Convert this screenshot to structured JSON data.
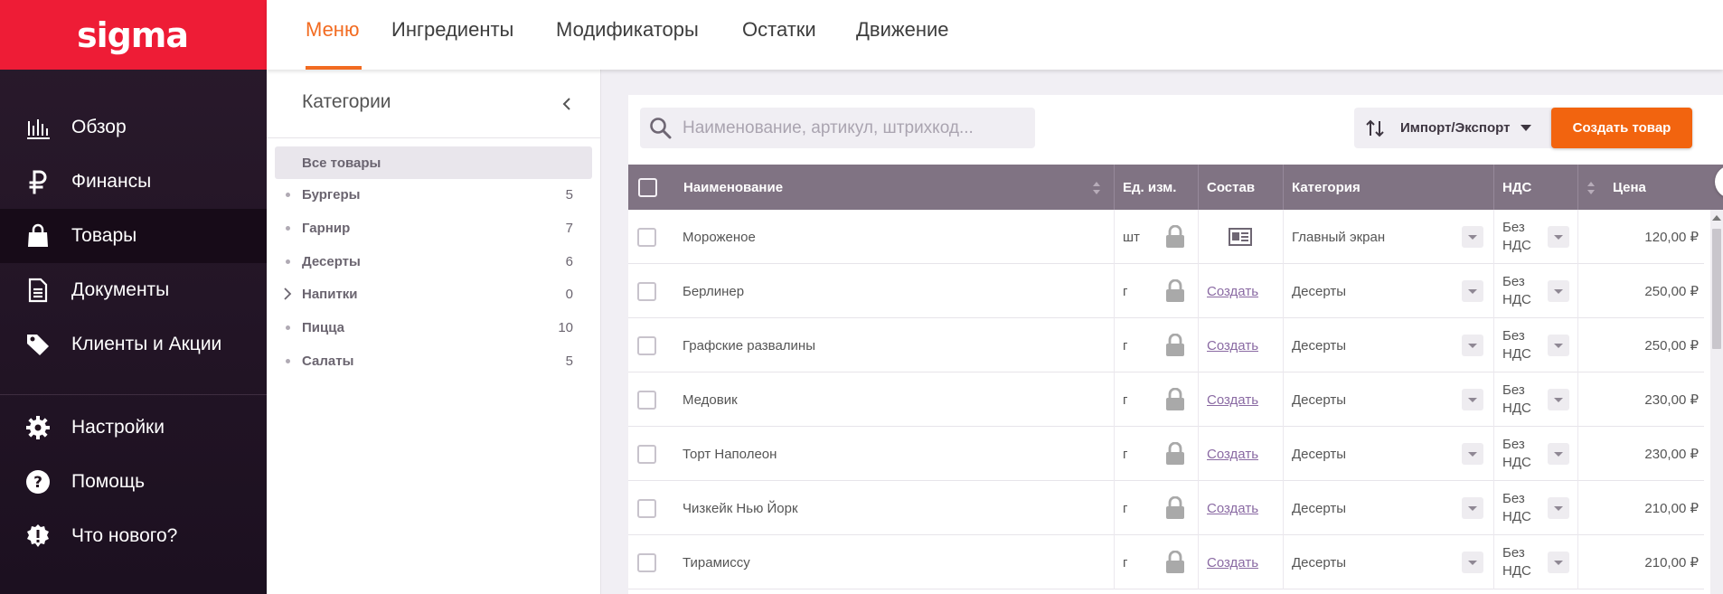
{
  "brand": {
    "logo": "sigma",
    "accent": "#f26b21",
    "brand_red": "#ee1c36"
  },
  "sidebar": {
    "items": [
      {
        "label": "Обзор",
        "icon": "chart-bars-icon"
      },
      {
        "label": "Финансы",
        "icon": "ruble-icon"
      },
      {
        "label": "Товары",
        "icon": "shopping-bag-icon",
        "active": true
      },
      {
        "label": "Документы",
        "icon": "document-icon"
      },
      {
        "label": "Клиенты и Акции",
        "icon": "tag-icon"
      }
    ],
    "bottom_items": [
      {
        "label": "Настройки",
        "icon": "gear-icon"
      },
      {
        "label": "Помощь",
        "icon": "help-icon"
      },
      {
        "label": "Что нового?",
        "icon": "news-badge-icon"
      }
    ]
  },
  "tabs": [
    "Меню",
    "Ингредиенты",
    "Модификаторы",
    "Остатки",
    "Движение"
  ],
  "active_tab": "Меню",
  "categories": {
    "title": "Категории",
    "all_label": "Все товары",
    "items": [
      {
        "name": "Бургеры",
        "count": "5"
      },
      {
        "name": "Гарнир",
        "count": "7"
      },
      {
        "name": "Десерты",
        "count": "6"
      },
      {
        "name": "Напитки",
        "count": "0",
        "expandable": true
      },
      {
        "name": "Пицца",
        "count": "10"
      },
      {
        "name": "Салаты",
        "count": "5"
      }
    ]
  },
  "toolbar": {
    "search_placeholder": "Наименование, артикул, штрихкод...",
    "import_label": "Импорт/Экспорт",
    "create_label": "Создать товар"
  },
  "table": {
    "headers": {
      "name": "Наименование",
      "unit": "Ед. изм.",
      "composition": "Состав",
      "category": "Категория",
      "vat": "НДС",
      "price": "Цена"
    },
    "rows": [
      {
        "name": "Мороженое",
        "unit": "шт",
        "composition": "",
        "composition_icon": "tech-card-icon",
        "category": "Главный экран",
        "vat": [
          "Без",
          "НДС"
        ],
        "price": "120,00 ₽"
      },
      {
        "name": "Берлинер",
        "unit": "г",
        "composition": "Создать",
        "category": "Десерты",
        "vat": [
          "Без",
          "НДС"
        ],
        "price": "250,00 ₽"
      },
      {
        "name": "Графские развалины",
        "unit": "г",
        "composition": "Создать",
        "category": "Десерты",
        "vat": [
          "Без",
          "НДС"
        ],
        "price": "250,00 ₽"
      },
      {
        "name": "Медовик",
        "unit": "г",
        "composition": "Создать",
        "category": "Десерты",
        "vat": [
          "Без",
          "НДС"
        ],
        "price": "230,00 ₽"
      },
      {
        "name": "Торт Наполеон",
        "unit": "г",
        "composition": "Создать",
        "category": "Десерты",
        "vat": [
          "Без",
          "НДС"
        ],
        "price": "230,00 ₽"
      },
      {
        "name": "Чизкейк Нью Йорк",
        "unit": "г",
        "composition": "Создать",
        "category": "Десерты",
        "vat": [
          "Без",
          "НДС"
        ],
        "price": "210,00 ₽"
      },
      {
        "name": "Тирамиссу",
        "unit": "г",
        "composition": "Создать",
        "category": "Десерты",
        "vat": [
          "Без",
          "НДС"
        ],
        "price": "210,00 ₽"
      }
    ]
  }
}
